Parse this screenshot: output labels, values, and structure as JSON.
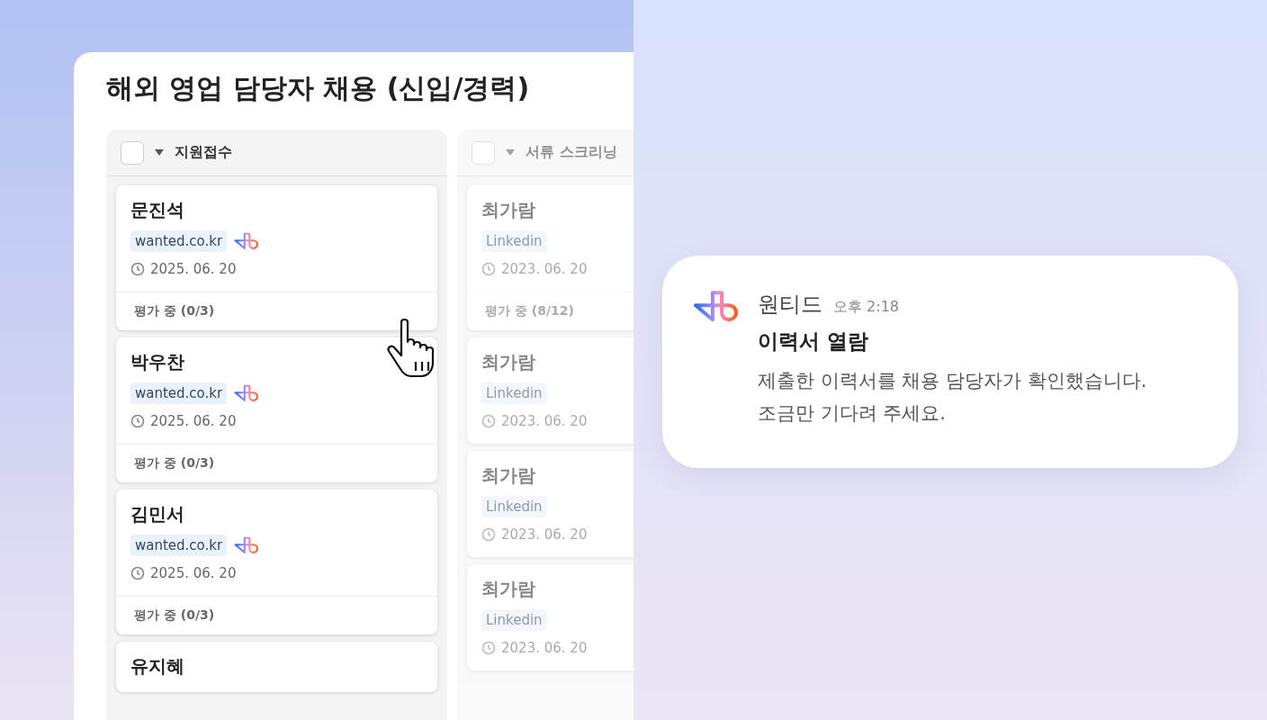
{
  "board": {
    "title": "해외 영업 담당자 채용 (신입/경력)",
    "columns": [
      {
        "name": "지원접수",
        "checked": false,
        "dimmed": false,
        "cards": [
          {
            "name": "문진석",
            "tag": "wanted.co.kr",
            "logo": true,
            "date": "2025. 06. 20",
            "status": "평가 중 (0/3)"
          },
          {
            "name": "박우찬",
            "tag": "wanted.co.kr",
            "logo": true,
            "date": "2025. 06. 20",
            "status": "평가 중 (0/3)"
          },
          {
            "name": "김민서",
            "tag": "wanted.co.kr",
            "logo": true,
            "date": "2025. 06. 20",
            "status": "평가 중 (0/3)"
          },
          {
            "name": "유지혜"
          }
        ]
      },
      {
        "name": "서류 스크리닝",
        "checked": false,
        "dimmed": true,
        "cards": [
          {
            "name": "최가람",
            "tag": "Linkedin",
            "logo": false,
            "date": "2023. 06. 20",
            "status": "평가 중 (8/12)"
          },
          {
            "name": "최가람",
            "tag": "Linkedin",
            "logo": false,
            "date": "2023. 06. 20"
          },
          {
            "name": "최가람",
            "tag": "Linkedin",
            "logo": false,
            "date": "2023. 06. 20"
          },
          {
            "name": "최가람",
            "tag": "Linkedin",
            "logo": false,
            "date": "2023. 06. 20"
          }
        ]
      }
    ]
  },
  "notification": {
    "app": "원티드",
    "time": "오후 2:18",
    "title": "이력서 열람",
    "body": [
      "제출한 이력서를 채용 담당자가 확인했습니다.",
      "조금만 기다려 주세요."
    ]
  }
}
